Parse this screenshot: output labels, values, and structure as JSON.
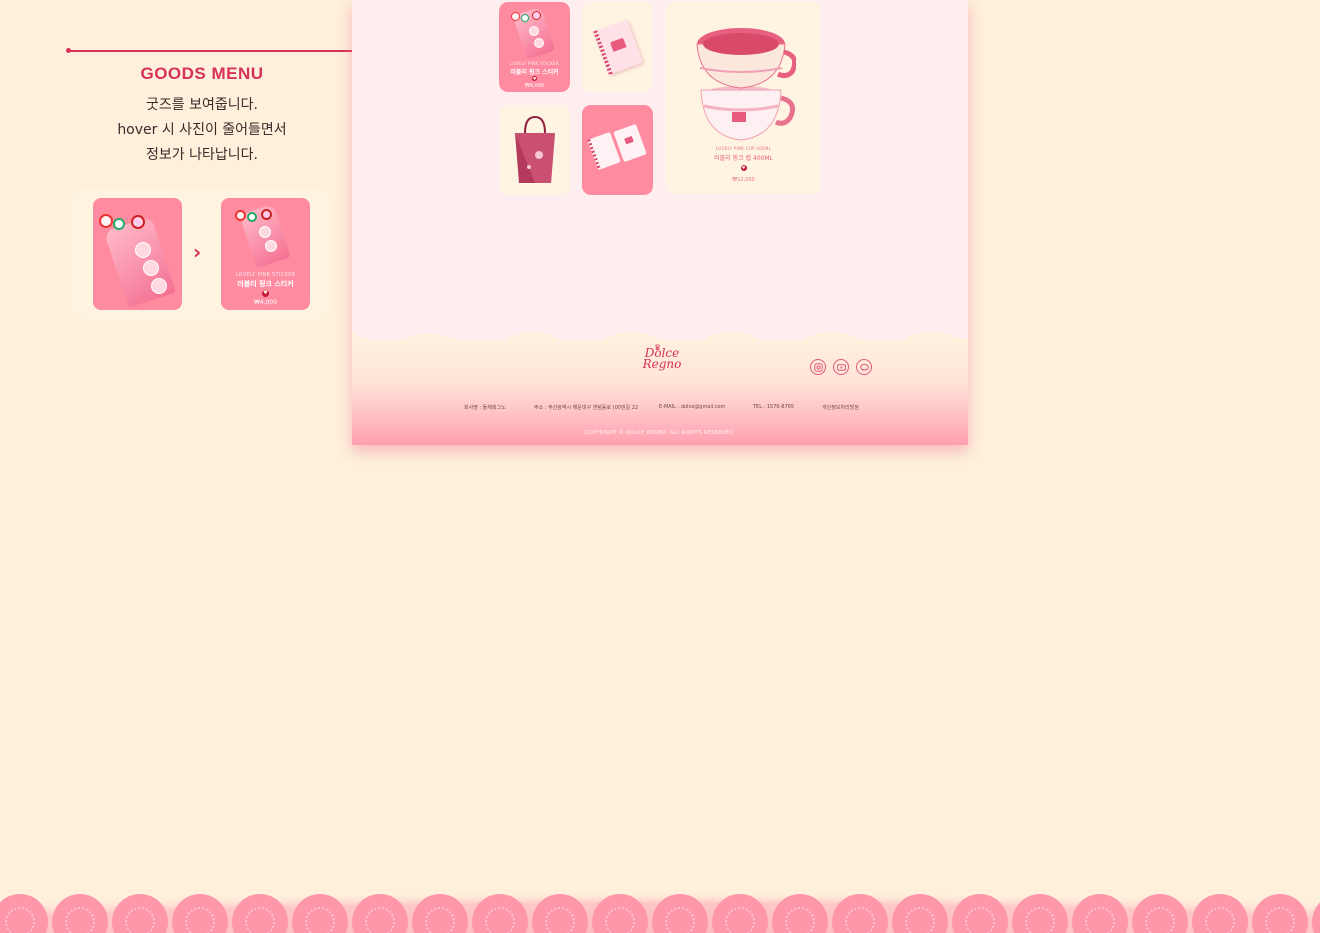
{
  "annotation": {
    "title": "GOODS MENU",
    "lines": [
      "굿즈를 보여줍니다.",
      "hover 시 사진이 줄어들면서",
      "정보가 나타납니다."
    ]
  },
  "demo": {
    "arrow": "›",
    "after_card": {
      "subtitle": "LOVELY PINK STICKER",
      "name": "러블리 핑크 스티커",
      "price": "₩4,000"
    }
  },
  "goods": {
    "sticker": {
      "subtitle": "LOVELY PINK STICKER",
      "name": "러블리 핑크 스티커",
      "price": "₩4,000"
    },
    "cup": {
      "subtitle": "LOVELY PINK CUP 400ML",
      "name": "러블리 핑크 컵 400ML",
      "price": "₩12,000"
    }
  },
  "footer": {
    "logo_line1": "Dolce",
    "logo_line2": "Regno",
    "company": "회사명 : 돌체레그노",
    "address": "주소 : 부산광역시 해운대구 센텀동로 (00번길 22",
    "email": "E-MAIL : dolce@gmail.com",
    "tel": "TEL : 1576-8765",
    "privacy": "개인정보처리방침",
    "copyright": "COPYRIGHT © DOLCE REGNO. ALL RIGHTS RESERVED."
  },
  "socials": [
    "instagram-icon",
    "youtube-icon",
    "talk-icon"
  ],
  "colors": {
    "background": "#fef0db",
    "accent": "#d8315a",
    "card_pink": "#ff8ba0",
    "mockup_bg": "#ffeef0"
  }
}
